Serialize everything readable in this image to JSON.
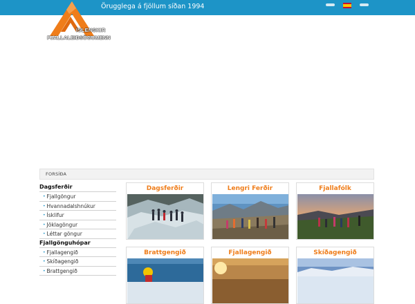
{
  "header": {
    "tagline": "Örugglega á fjöllum síðan 1994",
    "logo_line1": "ÍSLENSKIR",
    "logo_line2": "FJALLALEIÐSÖGUMENN",
    "language_flag": "spanish-flag-icon"
  },
  "breadcrumb": {
    "label": "FORSÍÐA"
  },
  "sidebar": {
    "sections": [
      {
        "heading": "Dagsferðir",
        "items": [
          "Fjallgöngur",
          "Hvannadalshnúkur",
          "Ísklifur",
          "Jöklagöngur",
          "Léttar göngur"
        ]
      },
      {
        "heading": "Fjallgönguhópar",
        "items": [
          "Fjallagengið",
          "Skíðagengið",
          "Brattgengið"
        ]
      }
    ]
  },
  "cards": [
    {
      "title": "Dagsferðir"
    },
    {
      "title": "Lengri Ferðir"
    },
    {
      "title": "Fjallafólk"
    },
    {
      "title": "Brattgengið"
    },
    {
      "title": "Fjallagengið"
    },
    {
      "title": "Skíðagengið"
    }
  ],
  "colors": {
    "topbar": "#1d94c7",
    "accent_orange": "#ef7d1a"
  }
}
